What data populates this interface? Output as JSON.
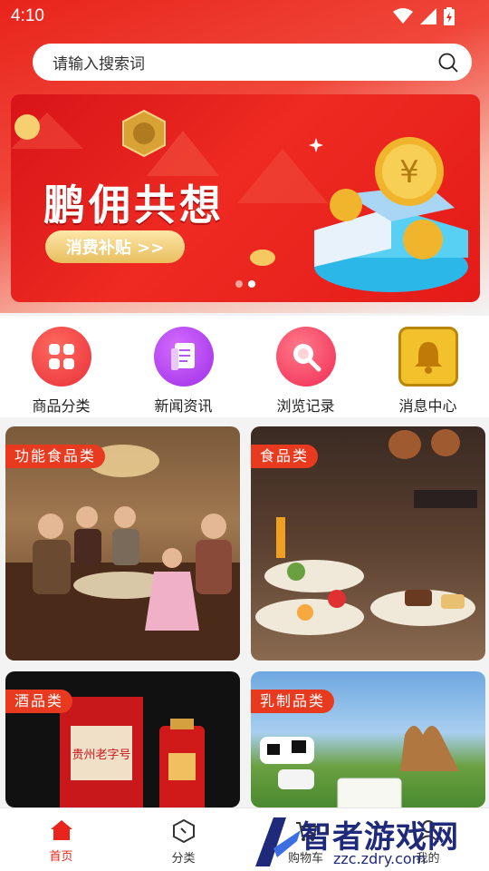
{
  "status_bar": {
    "time": "4:10"
  },
  "search": {
    "placeholder": "请输入搜索词"
  },
  "banner": {
    "title": "鹏佣共想",
    "button_label": "消费补贴 >>"
  },
  "quick_menu": [
    {
      "label": "商品分类",
      "icon": "grid-icon",
      "color": "#ef4a4a"
    },
    {
      "label": "新闻资讯",
      "icon": "document-icon",
      "color": "#b83ff0"
    },
    {
      "label": "浏览记录",
      "icon": "magnifier-icon",
      "color": "#ff3e61"
    },
    {
      "label": "消息中心",
      "icon": "bell-icon",
      "color": "#f3c12c"
    }
  ],
  "categories": [
    {
      "tag": "功能食品类"
    },
    {
      "tag": "食品类"
    },
    {
      "tag": "酒品类"
    },
    {
      "tag": "乳制品类"
    }
  ],
  "tabbar": [
    {
      "label": "首页",
      "icon": "home-icon"
    },
    {
      "label": "分类",
      "icon": "category-icon"
    },
    {
      "label": "购物车",
      "icon": "cart-icon"
    },
    {
      "label": "我的",
      "icon": "user-icon"
    }
  ],
  "watermark": {
    "brand": "智者游戏网",
    "url": "zzc.zdry.com"
  }
}
